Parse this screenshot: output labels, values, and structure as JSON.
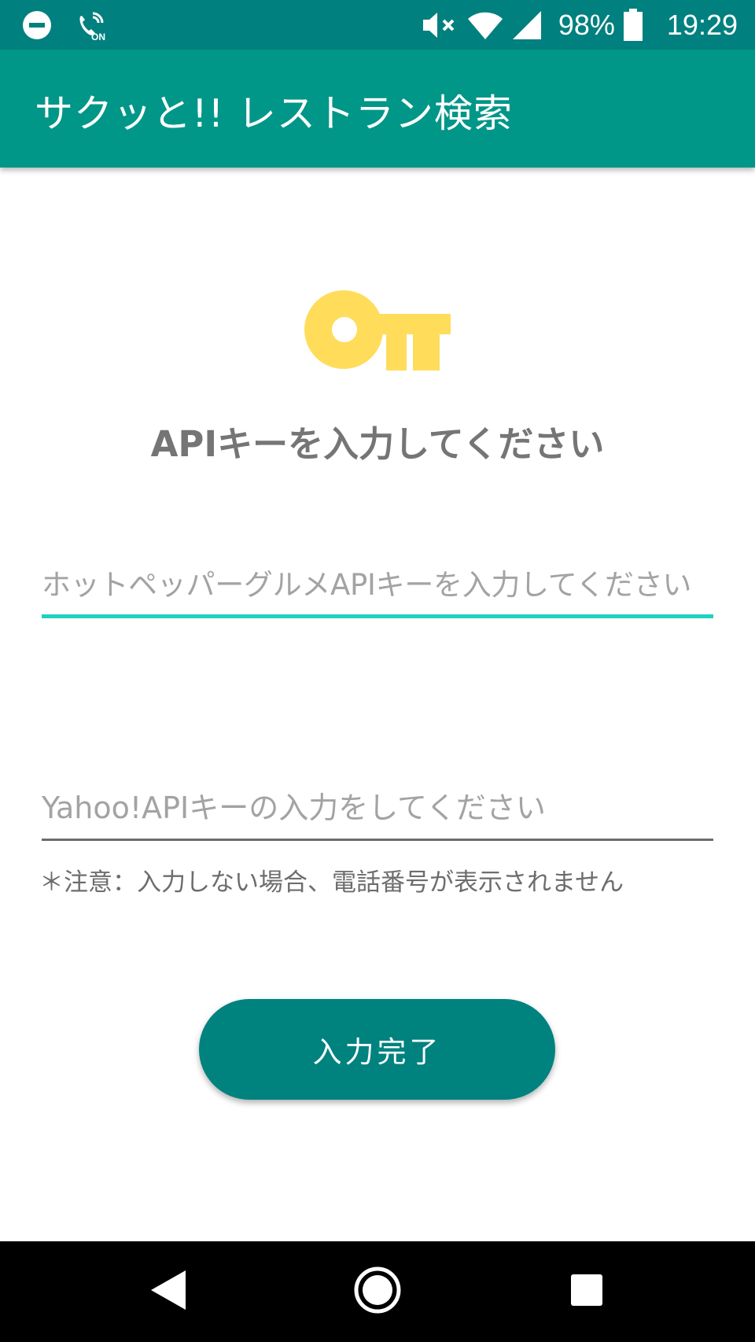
{
  "status_bar": {
    "icons_left": [
      "do-not-disturb-icon",
      "volte-on-icon"
    ],
    "volte_label": "ON",
    "icons_right": [
      "volume-muted-icon",
      "wifi-icon",
      "cell-signal-icon",
      "battery-icon"
    ],
    "battery_percent": "98%",
    "time": "19:29"
  },
  "app_bar": {
    "title": "サクッと!! レストラン検索"
  },
  "main": {
    "icon": "key-icon",
    "icon_color": "#FFDD5B",
    "heading": "APIキーを入力してください",
    "hotpepper_field": {
      "placeholder": "ホットペッパーグルメAPIキーを入力してください",
      "value": ""
    },
    "yahoo_field": {
      "placeholder": "Yahoo!APIキーの入力をしてください",
      "value": ""
    },
    "note": "＊注意：入力しない場合、電話番号が表示されません",
    "submit_label": "入力完了"
  },
  "colors": {
    "status_bar": "#00807F",
    "app_bar": "#009688",
    "accent": "#1ED1C1",
    "button": "#00827F"
  },
  "nav_bar": {
    "buttons": [
      "back-icon",
      "home-icon",
      "recents-icon"
    ]
  }
}
